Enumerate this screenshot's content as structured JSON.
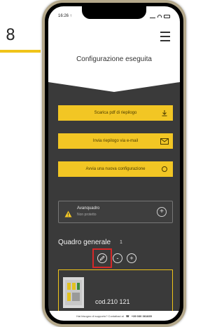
{
  "annotation": {
    "step_number": "8"
  },
  "statusbar": {
    "time": "16:26 ↑"
  },
  "header": {
    "title": "Configurazione eseguita"
  },
  "actions": {
    "download_label": "Scarica pdf di riepilogo",
    "email_label": "Invia riepilogo via e-mail",
    "new_config_label": "Avvia una nuova configurazione"
  },
  "card": {
    "title": "Avanquadro",
    "subtitle": "Non protetto"
  },
  "section": {
    "title": "Quadro generale",
    "count": "1"
  },
  "controls": {
    "minus": "-",
    "plus": "+"
  },
  "product": {
    "code": "cod.210 121"
  },
  "footer": {
    "text": "Hai bisogno di supporto? Contattaci al",
    "phone": "+39 030 361835"
  },
  "colors": {
    "accent": "#f2c624",
    "dark_bg": "#3a3a3a",
    "highlight": "#d62828"
  }
}
